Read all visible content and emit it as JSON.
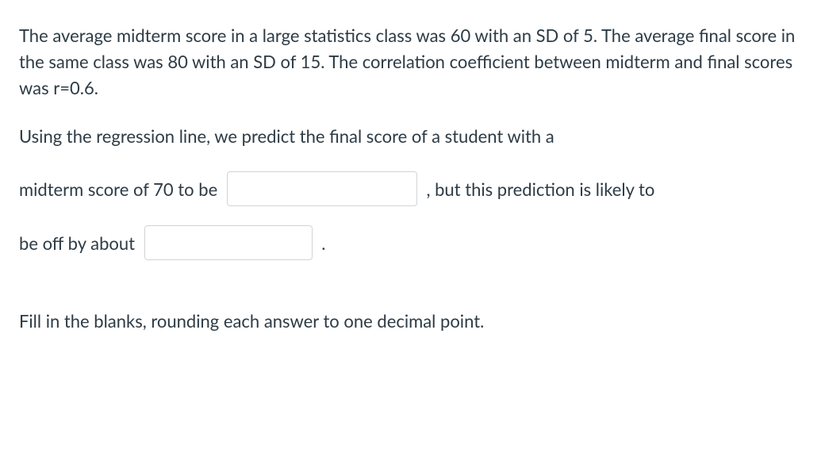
{
  "problem": {
    "paragraph1": "The average midterm score in a large statistics class was 60 with an SD of 5. The average final score in the same class was 80 with an SD of 15. The correlation coefficient between midterm and final scores was r=0.6.",
    "line2_pre": "Using the regression line, we predict the final score of a student with a",
    "line3_pre": "midterm score of 70 to be ",
    "line3_post": " , but this prediction is likely to",
    "line4_pre": "be off by about ",
    "line4_post": " .",
    "instruction": "Fill in the blanks, rounding each answer to one decimal point."
  },
  "inputs": {
    "prediction_value": "",
    "error_value": ""
  }
}
